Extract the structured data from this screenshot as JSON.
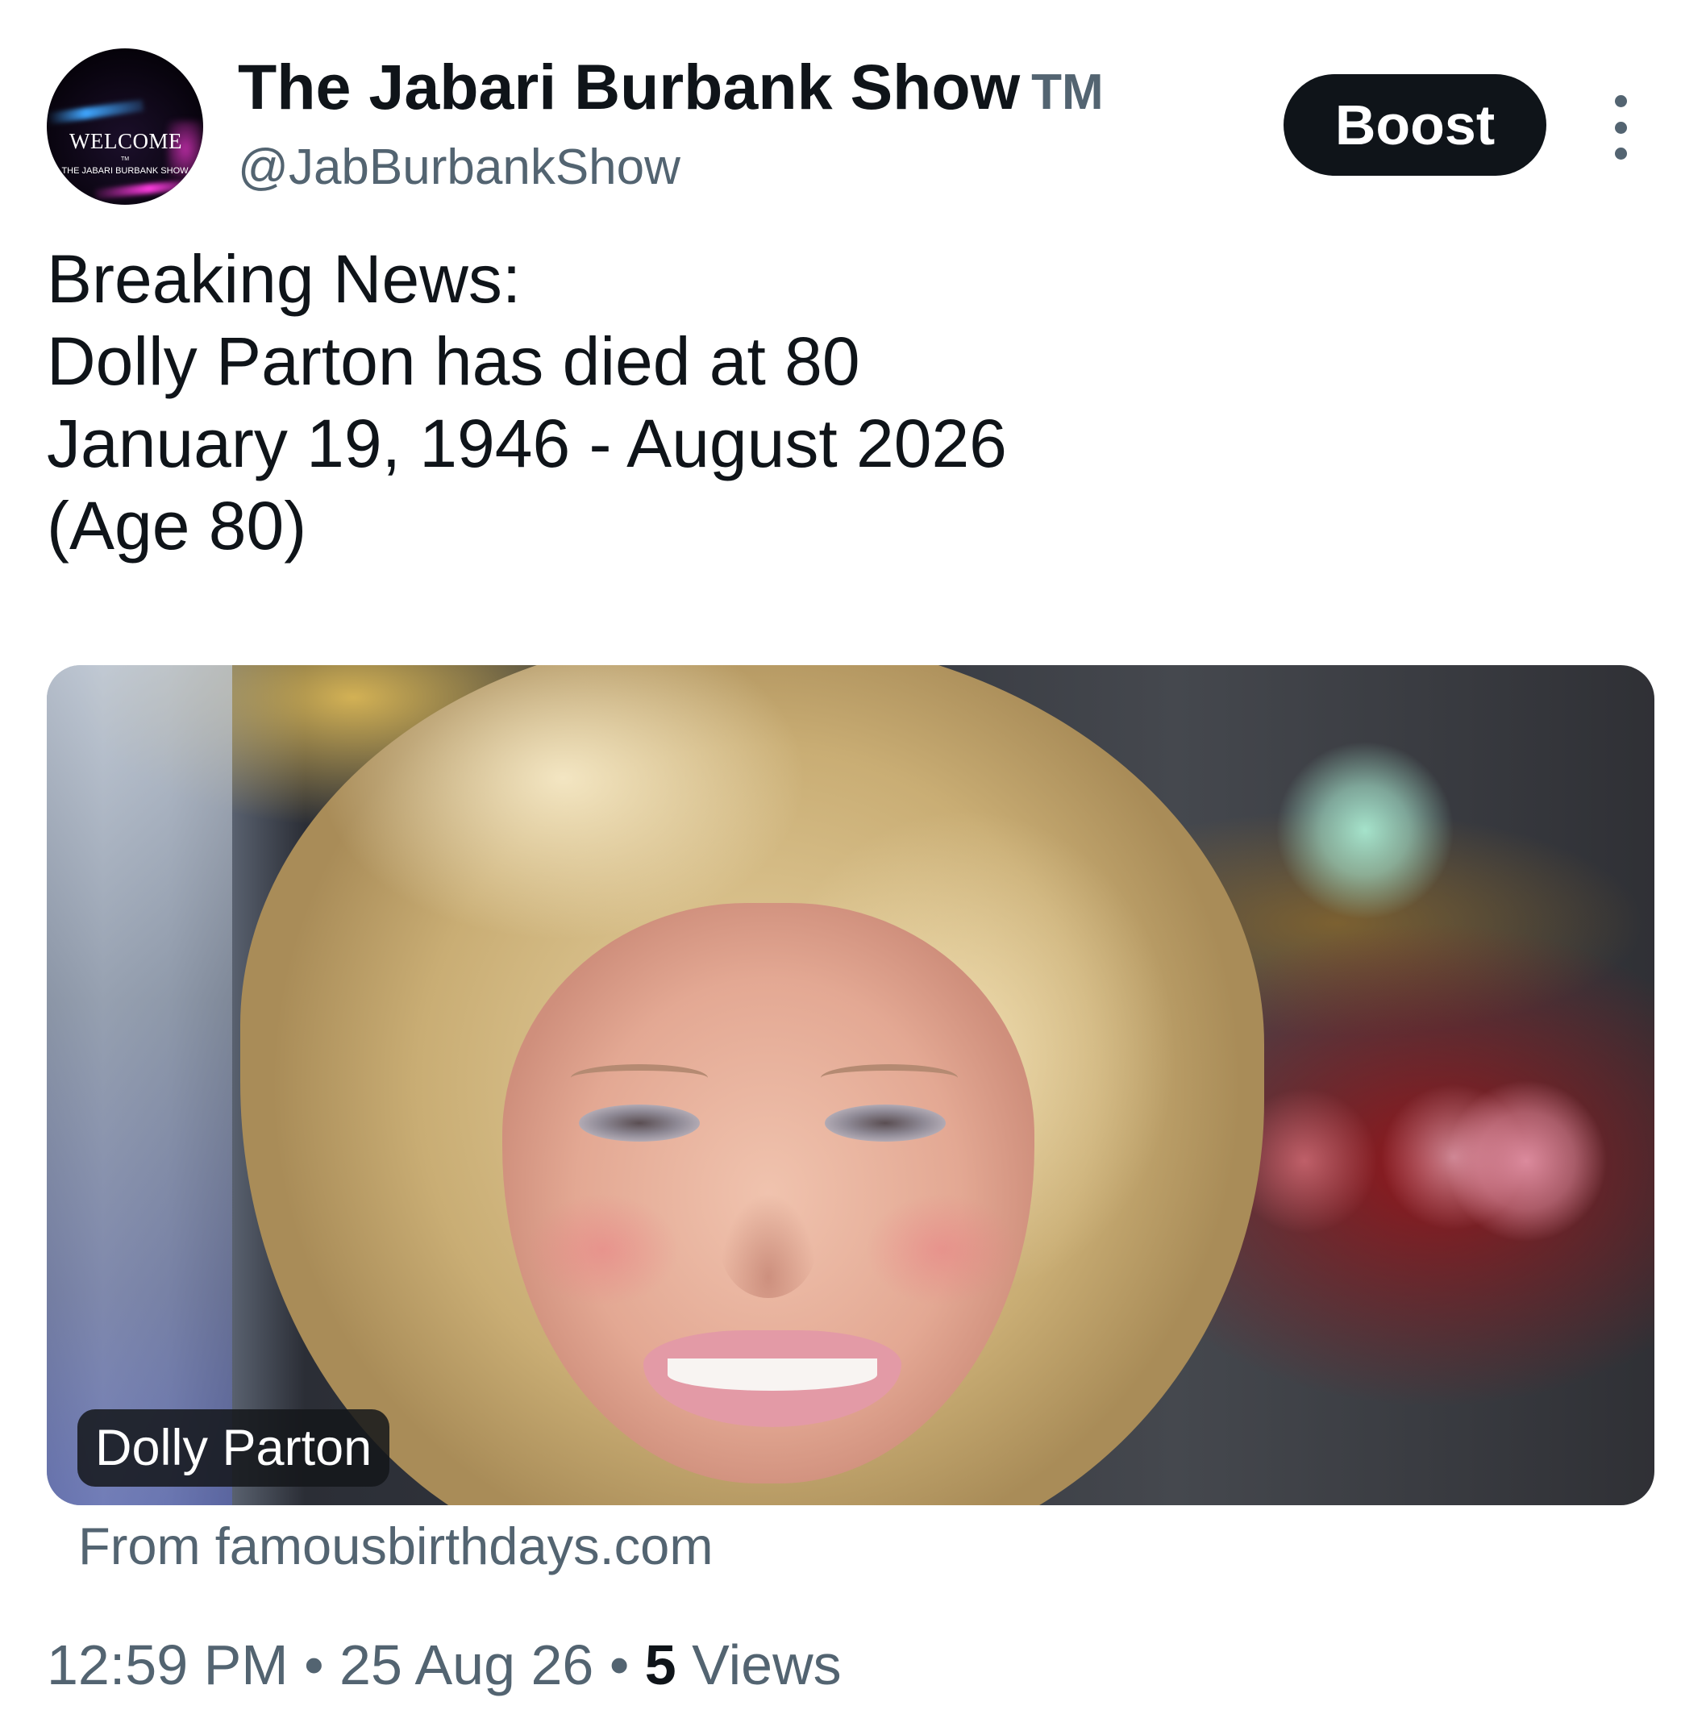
{
  "profile": {
    "avatar_text": "WELCOME",
    "avatar_tm": "TM",
    "avatar_subtext": "THE JABARI BURBANK SHOW",
    "display_name": "The Jabari Burbank Show",
    "name_suffix": "TM",
    "handle": "@JabBurbankShow"
  },
  "actions": {
    "boost_label": "Boost",
    "more_icon": "more-vertical-icon"
  },
  "tweet": {
    "lines": [
      "Breaking News:",
      "Dolly Parton has died at 80",
      "January 19, 1946 - August 2026",
      "(Age 80)"
    ]
  },
  "media": {
    "tag_label": "Dolly Parton",
    "source": "From famousbirthdays.com"
  },
  "meta": {
    "time": "12:59 PM",
    "separator": "•",
    "date": "25 Aug 26",
    "views_count": "5",
    "views_label": "Views"
  },
  "colors": {
    "text_primary": "#0f1419",
    "text_secondary": "#536471",
    "button_bg": "#0f1419",
    "background": "#ffffff"
  }
}
